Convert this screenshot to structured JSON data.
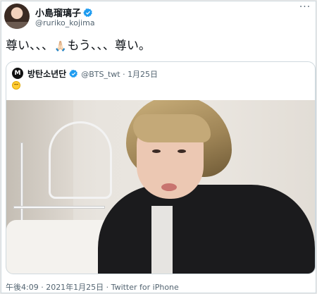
{
  "author": {
    "display_name": "小島瑠璃子",
    "handle": "@ruriko_kojima",
    "verified": true,
    "avatar_icon": "profile-photo"
  },
  "tweet": {
    "text_before": "尊い、、、",
    "emoji": "🙏🏻",
    "text_after": "もう、、、尊い。"
  },
  "quoted_tweet": {
    "display_name": "방탄소년단",
    "handle_and_date": "@BTS_twt · 1月25日",
    "verified": true,
    "avatar_icon": "bts-logo",
    "avatar_glyph": "M",
    "emoji_icon": "smiling-face-emoji"
  },
  "footer": {
    "meta": "午後4:09 · 2021年1月25日 · Twitter for iPhone"
  },
  "menu": {
    "more_glyph": "···"
  },
  "colors": {
    "verified_blue": "#1d9bf0",
    "secondary_text": "#536471",
    "border": "#cfd9de"
  }
}
